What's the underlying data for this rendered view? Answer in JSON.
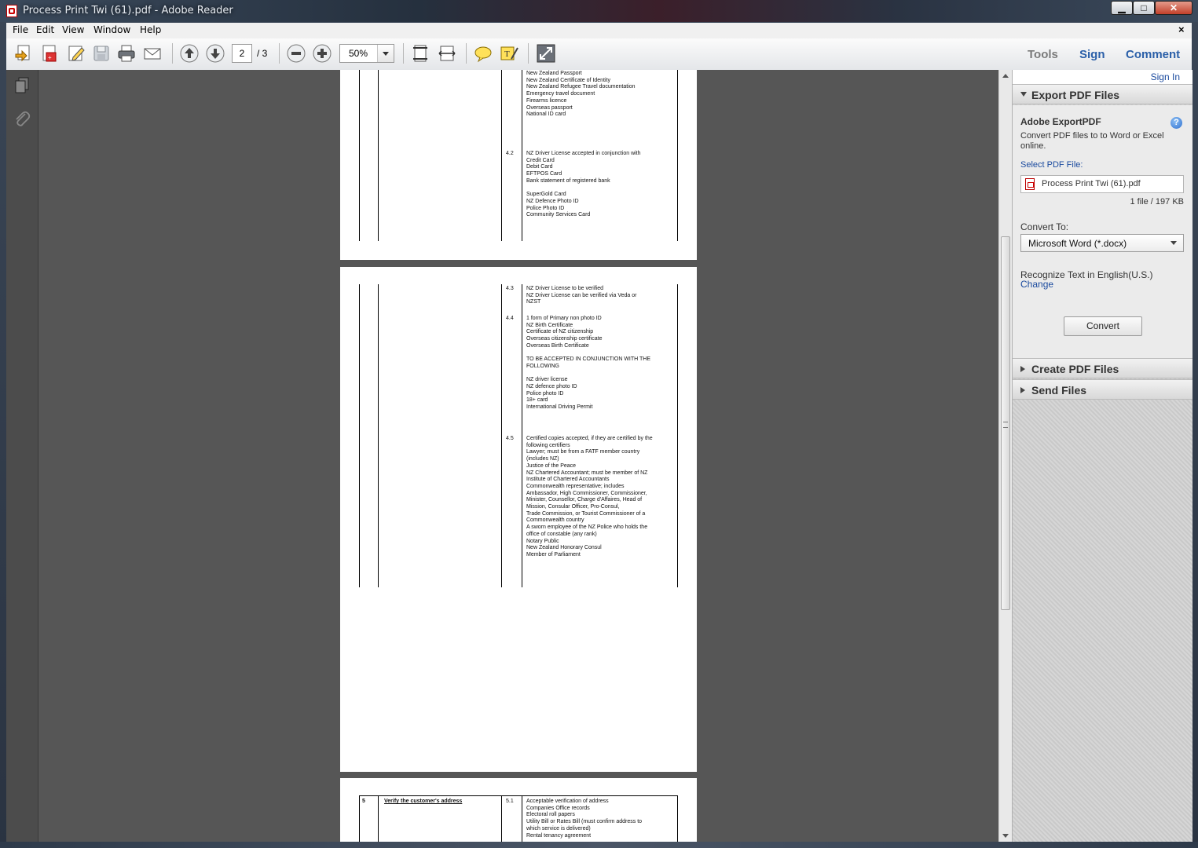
{
  "window": {
    "title": "Process Print Twi (61).pdf - Adobe Reader"
  },
  "menu": [
    "File",
    "Edit",
    "View",
    "Window",
    "Help"
  ],
  "toolbar": {
    "current_page": "2",
    "total_pages": "/ 3",
    "zoom": "50%",
    "icons": [
      "open-icon",
      "create-pdf-icon",
      "edit-icon",
      "save-icon",
      "print-icon",
      "email-icon",
      "prev-page-icon",
      "next-page-icon",
      "zoom-out-icon",
      "zoom-in-icon",
      "fit-page-icon",
      "fit-width-icon",
      "sticky-note-icon",
      "highlight-icon",
      "read-mode-icon"
    ]
  },
  "panes": {
    "tools": "Tools",
    "sign": "Sign",
    "comment": "Comment"
  },
  "right_panel": {
    "sign_in": "Sign In",
    "export_header": "Export PDF Files",
    "export_title": "Adobe ExportPDF",
    "export_desc": "Convert PDF files to to Word or Excel online.",
    "select_label": "Select PDF File:",
    "file_name": "Process Print Twi (61).pdf",
    "file_count": "1 file / 197 KB",
    "convert_to_label": "Convert To:",
    "convert_to_value": "Microsoft Word (*.docx)",
    "recognize_text": "Recognize Text in English(U.S.)",
    "change_link": "Change",
    "convert_button": "Convert",
    "create_header": "Create PDF Files",
    "send_header": "Send Files"
  },
  "document": {
    "page1_lines": "New Zealand Passport\nNew Zealand Certificate of Identity\nNew Zealand Refugee Travel documentation\nEmergency travel document\nFirearms licence\nOverseas passport\nNational ID card",
    "page1_n42": "4.2",
    "page1_lines2": "NZ Driver License accepted in conjunction with\nCredit Card\nDebit Card\nEFTPOS Card\nBank statement of registered bank\n\nSuperGold Card\nNZ Defence Photo ID\nPolice Photo ID\nCommunity Services Card",
    "p2_n43": "4.3",
    "p2_t43": "NZ Driver License to be verified\nNZ Driver License can be verified via Veda or\nNZST",
    "p2_n44": "4.4",
    "p2_t44": "1 form of Primary non photo ID\nNZ Birth Certificate\nCertificate of NZ citizenship\nOverseas citizenship certificate\nOverseas Birth Certificate\n\nTO BE ACCEPTED IN CONJUNCTION WITH THE\nFOLLOWING\n\nNZ driver license\nNZ defence photo ID\nPolice photo ID\n18+ card\nInternational Driving Permit",
    "p2_n45": "4.5",
    "p2_t45": "Certified copies accepted, if they are certified by the\nfollowing certifiers\nLawyer; must be from a FATF member country\n(includes NZ)\nJustice of the Peace\nNZ Chartered Accountant; must be member of NZ\nInstitute of Chartered Accountants\nCommonwealth representative; includes\nAmbassador, High Commissioner, Commissioner,\nMinister, Counsellor, Charge d'Affaires, Head of\nMission, Consular Officer, Pro-Consul,\nTrade Commission, or Tourist Commissioner of a\nCommonwealth country\nA sworn employee of the NZ Police who holds the\noffice of constable (any rank)\nNotary Public\nNew Zealand Honorary Consul\nMember of Parliament",
    "p3_num": "5",
    "p3_title": "Verify the customer's address",
    "p3_n51": "5.1",
    "p3_t51": "Acceptable verification of address\nCompanies Office records\nElectoral roll papers\nUtility Bill or Rates Bill (must confirm address to\nwhich service is delivered)\nRental tenancy agreement"
  }
}
